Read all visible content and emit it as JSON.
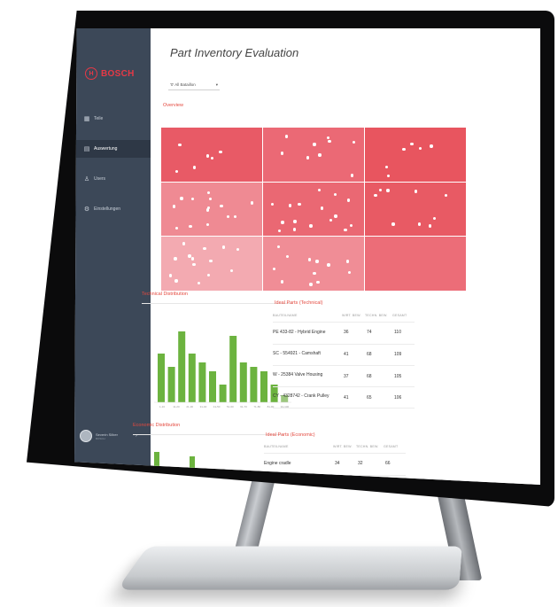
{
  "sidebar": {
    "brand": "BOSCH",
    "items": [
      {
        "label": "Teile",
        "icon": "parts-icon",
        "glyph": "▦"
      },
      {
        "label": "Auswertung",
        "icon": "evaluation-icon",
        "glyph": "▤"
      },
      {
        "label": "Users",
        "icon": "users-icon",
        "glyph": "♙"
      },
      {
        "label": "Einstellungen",
        "icon": "settings-icon",
        "glyph": "⚙"
      }
    ],
    "active_index": 1,
    "user": {
      "name": "Severin Silber",
      "subtitle": "BOSCH"
    }
  },
  "page": {
    "title": "Part Inventory Evaluation",
    "filter_value": "'0' All Bataillon"
  },
  "overview": {
    "title": "Overview",
    "colors": [
      "#e85a66",
      "#eb6975",
      "#e8555f",
      "#ef8a93",
      "#ea6873",
      "#e85a64",
      "#f3aab1",
      "#f08d96",
      "#ec6d78"
    ]
  },
  "technical_distribution": {
    "title": "Technical Distribution",
    "chart_data": {
      "type": "bar",
      "categories": [
        "1-10",
        "11-20",
        "21-30",
        "31-40",
        "41-50",
        "51-60",
        "61-70",
        "71-80",
        "81-90",
        "91-100"
      ],
      "series": [
        {
          "values": [
            55,
            40,
            80,
            55,
            45,
            35,
            20,
            75,
            45,
            40,
            35,
            20,
            8
          ]
        }
      ],
      "bar_count": 13,
      "color": "#6cb33f",
      "ylim": [
        0,
        85
      ]
    }
  },
  "ideal_parts_technical": {
    "title": "Ideal Parts (Technical)",
    "headers": [
      "BAUTEILNAME",
      "WIRT. BEW.",
      "TECHN. BEW.",
      "GESAMT"
    ],
    "rows": [
      [
        "PE 433-82 - Hybrid Engine",
        "36",
        "74",
        "110"
      ],
      [
        "SC - 554921 - Camshaft",
        "41",
        "68",
        "109"
      ],
      [
        "W - 25384 Valve Housing",
        "37",
        "68",
        "105"
      ],
      [
        "CY - 4328742 - Crank Pulley",
        "41",
        "65",
        "106"
      ]
    ]
  },
  "economic_distribution": {
    "title": "Economic Distribution"
  },
  "ideal_parts_economic": {
    "title": "Ideal Parts (Economic)",
    "headers": [
      "BAUTEILNAME",
      "WIRT. BEW.",
      "TECHN. BEW.",
      "GESAMT"
    ],
    "rows": [
      [
        "Engine cradle",
        "34",
        "32",
        "66"
      ]
    ]
  }
}
